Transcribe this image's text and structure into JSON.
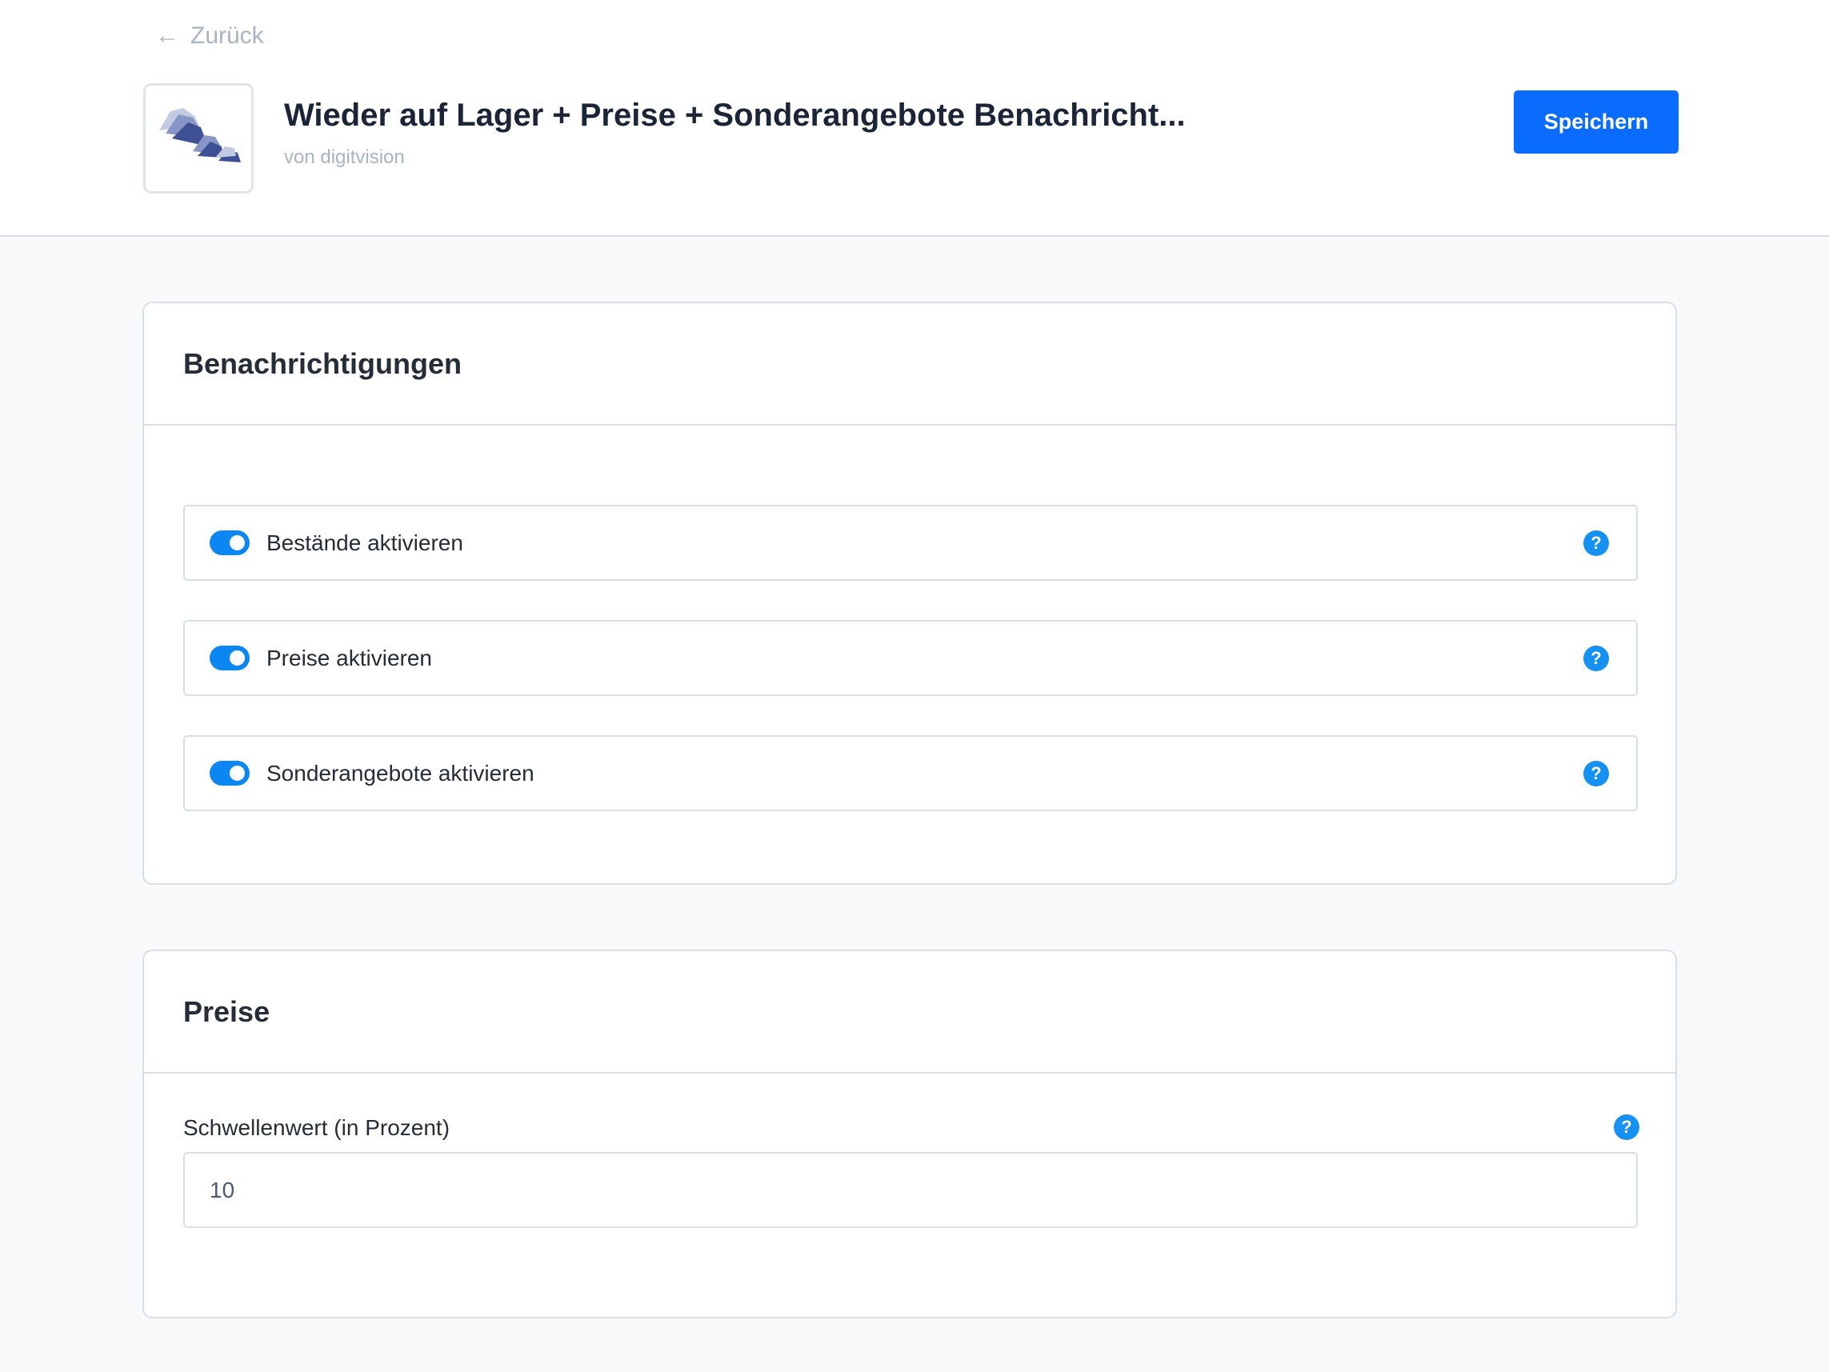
{
  "header": {
    "back_label": "Zurück",
    "app_title": "Wieder auf Lager + Preise + Sonderangebote Benachricht...",
    "app_vendor": "von digitvision",
    "save_label": "Speichern"
  },
  "notifications": {
    "title": "Benachrichtigungen",
    "toggles": [
      {
        "label": "Bestände aktivieren",
        "enabled": true
      },
      {
        "label": "Preise aktivieren",
        "enabled": true
      },
      {
        "label": "Sonderangebote aktivieren",
        "enabled": true
      }
    ]
  },
  "prices": {
    "title": "Preise",
    "threshold_label": "Schwellenwert (in Prozent)",
    "threshold_value": "10"
  },
  "icons": {
    "back": "arrow-left-icon",
    "help": "question-mark-icon",
    "help_glyph": "?"
  },
  "colors": {
    "accent": "#0a6cff",
    "toggle_on": "#0c86f0",
    "help": "#1491f2"
  }
}
